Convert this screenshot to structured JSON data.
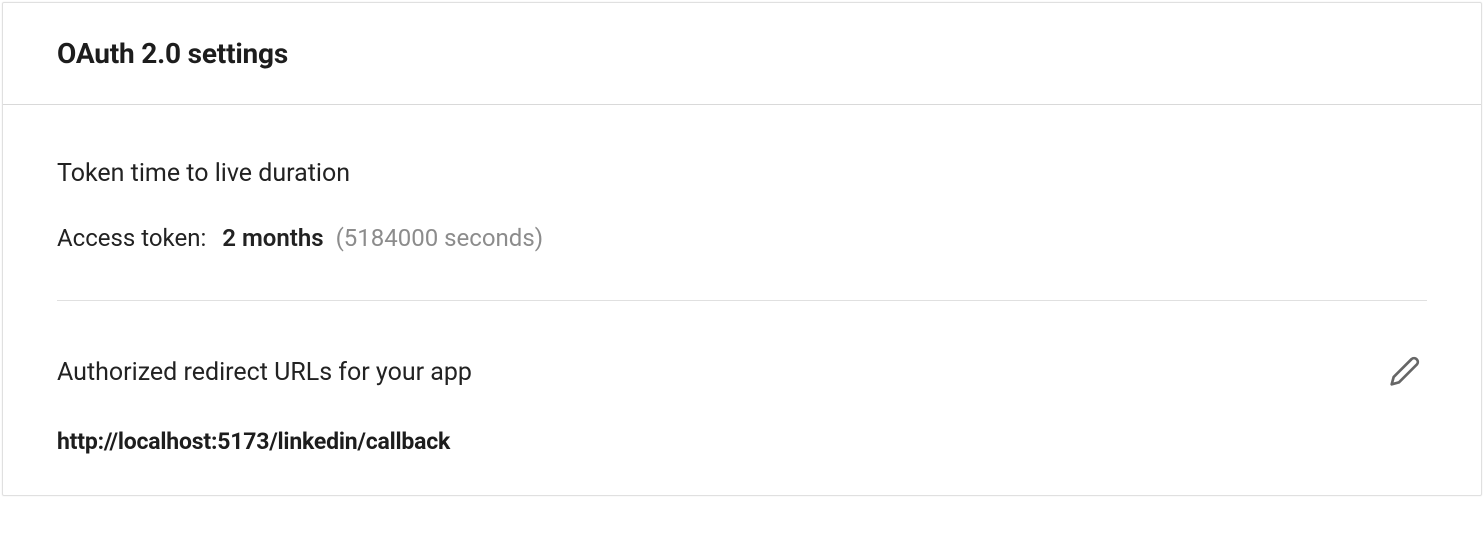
{
  "card": {
    "title": "OAuth 2.0 settings"
  },
  "token": {
    "section_title": "Token time to live duration",
    "label": "Access token:",
    "value": "2 months",
    "seconds": "(5184000 seconds)"
  },
  "redirect": {
    "section_title": "Authorized redirect URLs for your app",
    "urls": [
      "http://localhost:5173/linkedin/callback"
    ]
  },
  "icons": {
    "edit": "pencil-icon"
  }
}
